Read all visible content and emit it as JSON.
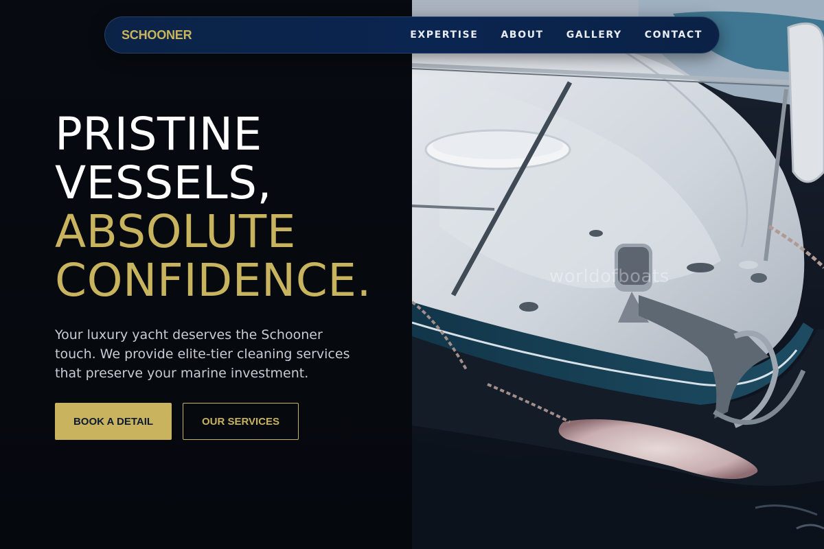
{
  "brand": {
    "name": "SCHOONER"
  },
  "nav": {
    "items": [
      {
        "label": "EXPERTISE"
      },
      {
        "label": "ABOUT"
      },
      {
        "label": "GALLERY"
      },
      {
        "label": "CONTACT"
      }
    ]
  },
  "hero": {
    "headline_lines": [
      {
        "text": "PRISTINE",
        "tone": "white"
      },
      {
        "text": "VESSELS,",
        "tone": "white"
      },
      {
        "text": "ABSOLUTE",
        "tone": "gold"
      },
      {
        "text": "CONFIDENCE.",
        "tone": "gold"
      }
    ],
    "description": "Your luxury yacht deserves the Schooner touch. We provide elite-tier cleaning services that preserve your marine investment.",
    "primary_button": "BOOK A DETAIL",
    "secondary_button": "OUR SERVICES"
  },
  "photo": {
    "watermark": "worldofboats"
  },
  "colors": {
    "gold": "#c9b35e",
    "navy": "#0a2550",
    "background": "#05090e",
    "text_light": "#c8ccd3"
  }
}
